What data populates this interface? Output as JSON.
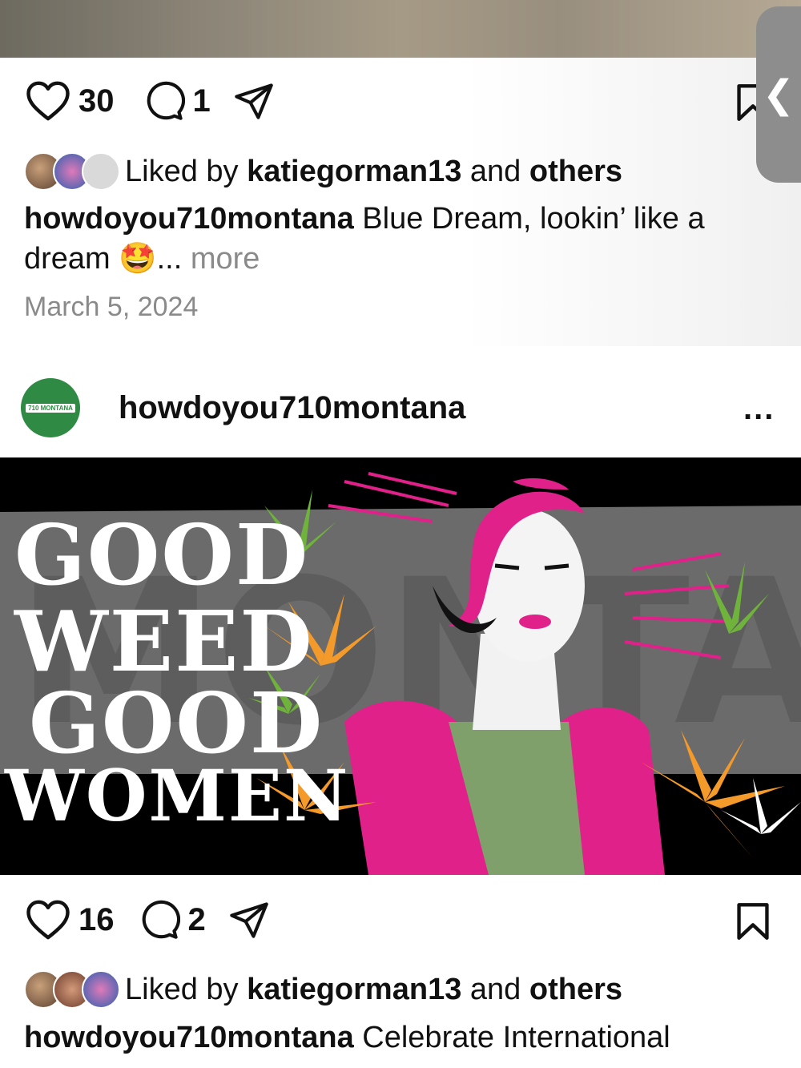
{
  "post1": {
    "likes": "30",
    "comments": "1",
    "liked_by_prefix": "Liked by",
    "liked_by_user": "katiegorman13",
    "liked_by_and": "and",
    "liked_by_others": "others",
    "caption_user": "howdoyou710montana",
    "caption_text": "Blue Dream, lookin’ like a dream",
    "caption_emoji": "🤩",
    "caption_ellipsis": "...",
    "more_label": "more",
    "date": "March 5, 2024"
  },
  "post2": {
    "username": "howdoyou710montana",
    "avatar_logo_text": "710 MONTANA",
    "menu_label": "...",
    "poster_lines": [
      "GOOD",
      "WEED",
      "GOOD",
      "WOMEN"
    ],
    "likes": "16",
    "comments": "2",
    "liked_by_prefix": "Liked by",
    "liked_by_user": "katiegorman13",
    "liked_by_and": "and",
    "liked_by_others": "others",
    "caption_user": "howdoyou710montana",
    "caption_text": "Celebrate International"
  },
  "side_tab": {
    "glyph": "❮"
  },
  "colors": {
    "logo_green": "#2f8a44",
    "poster_bg": "#000000",
    "magenta": "#e0218a",
    "sage": "#7fa06a"
  }
}
